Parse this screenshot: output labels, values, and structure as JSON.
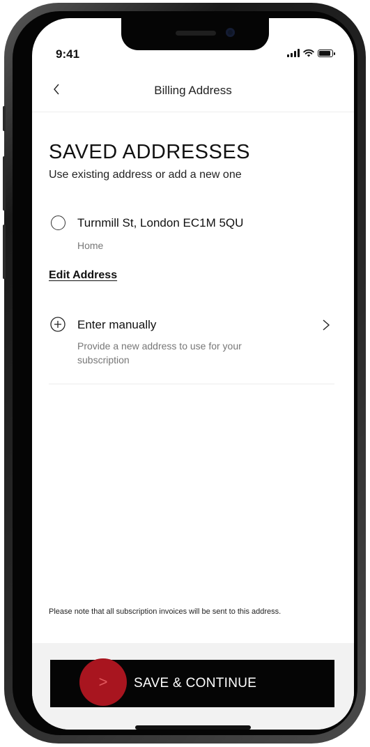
{
  "status_bar": {
    "time": "9:41"
  },
  "nav": {
    "title": "Billing Address",
    "back_icon": "chevron-left-icon"
  },
  "section": {
    "heading": "SAVED ADDRESSES",
    "subheading": "Use existing address or add a new one"
  },
  "saved_address": {
    "line": "Turnmill St, London EC1M 5QU",
    "tag": "Home",
    "selected": false
  },
  "edit_link": "Edit Address",
  "manual_entry": {
    "title": "Enter manually",
    "description": "Provide a new address to use for your subscription",
    "icon": "plus-circle-icon"
  },
  "note": "Please note that all subscription invoices will be sent to this address.",
  "save_button": {
    "label": "SAVE & CONTINUE",
    "arrow": ">"
  },
  "colors": {
    "accent_red": "#a8151f",
    "button_bg": "#050505",
    "text_primary": "#111111",
    "text_secondary": "#777777"
  }
}
